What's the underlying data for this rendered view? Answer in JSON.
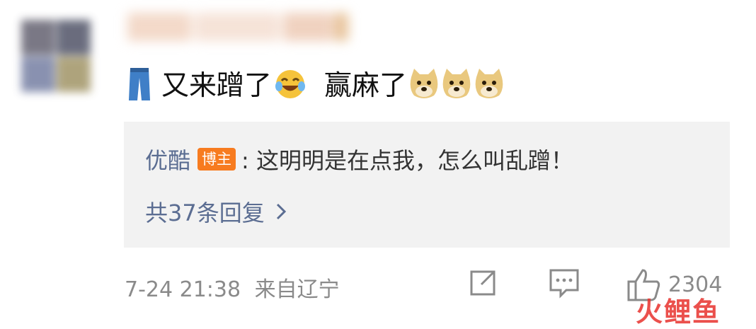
{
  "avatar": {
    "tiles": [
      "#6c6a78",
      "#5a5d70",
      "#7d86a8",
      "#a69a6e"
    ]
  },
  "comment": {
    "icons": [
      "jeans-emoji",
      "laughing-tears-emoji",
      "doge-emoji",
      "doge-emoji",
      "doge-emoji"
    ],
    "text_1": "又来蹭了",
    "text_2": "赢麻了"
  },
  "reply": {
    "author": "优酷",
    "badge": "博主",
    "text": ": 这明明是在点我，怎么叫乱蹭！",
    "count_label": "共37条回复"
  },
  "footer": {
    "timestamp": "7-24 21:38",
    "source": "来自辽宁",
    "like_count": "2304"
  },
  "watermark": {
    "text": "火鲤鱼"
  },
  "colors": {
    "link": "#5b6d92",
    "badge": "#f77b1f",
    "meta": "#8a8a8a",
    "reply_bg": "#f2f2f2"
  }
}
